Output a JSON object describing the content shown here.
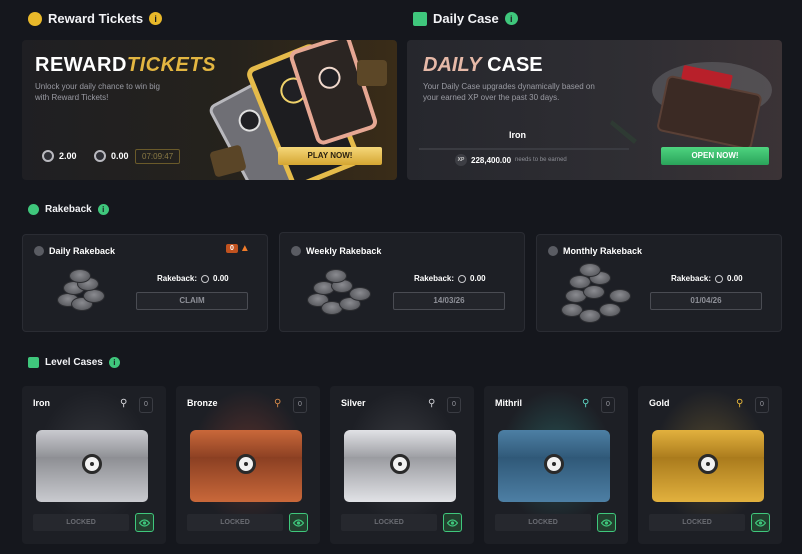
{
  "sections": {
    "reward_tickets": "Reward Tickets",
    "daily_case": "Daily Case",
    "rakeback": "Rakeback",
    "level_cases": "Level Cases"
  },
  "reward_banner": {
    "title_a": "REWARD",
    "title_b": "TICKETS",
    "desc1": "Unlock your daily chance to win big",
    "desc2": "with Reward Tickets!",
    "stat1": "2.00",
    "stat2": "0.00",
    "timer": "07:09:47",
    "play_label": "PLAY NOW!"
  },
  "daily_banner": {
    "title_a": "DAILY",
    "title_b": "CASE",
    "desc1": "Your Daily Case upgrades dynamically based on",
    "desc2": "your earned XP over the past 30 days.",
    "tier": "Iron",
    "xp_icon": "XP",
    "xp_value": "228,400.00",
    "xp_note": "needs to be earned",
    "open_label": "OPEN NOW!"
  },
  "rakeback_cards": [
    {
      "title": "Daily Rakeback",
      "label": "Rakeback:",
      "value": "0.00",
      "button": "CLAIM",
      "streak": "0"
    },
    {
      "title": "Weekly Rakeback",
      "label": "Rakeback:",
      "value": "0.00",
      "button": "14/03/26"
    },
    {
      "title": "Monthly Rakeback",
      "label": "Rakeback:",
      "value": "0.00",
      "button": "01/04/26"
    }
  ],
  "level_cases": [
    {
      "name": "Iron",
      "count": "0",
      "locked": "LOCKED",
      "key_color": "#d9d9de",
      "lid": "#c9cacf",
      "body": "#8d8e93",
      "glow": "rgba(255,255,255,0.10)"
    },
    {
      "name": "Bronze",
      "count": "0",
      "locked": "LOCKED",
      "key_color": "#d88a4a",
      "lid": "#c9683a",
      "body": "#8a3f22",
      "glow": "rgba(230,90,60,0.28)"
    },
    {
      "name": "Silver",
      "count": "0",
      "locked": "LOCKED",
      "key_color": "#cfd0d5",
      "lid": "#e1e2e6",
      "body": "#9a9ba0",
      "glow": "rgba(255,255,255,0.12)"
    },
    {
      "name": "Mithril",
      "count": "0",
      "locked": "LOCKED",
      "key_color": "#5fd6c4",
      "lid": "#4d7fa4",
      "body": "#2f5877",
      "glow": "rgba(60,200,190,0.28)"
    },
    {
      "name": "Gold",
      "count": "0",
      "locked": "LOCKED",
      "key_color": "#e8b83a",
      "lid": "#e2b13e",
      "body": "#a97a1c",
      "glow": "rgba(240,190,70,0.25)"
    }
  ],
  "icons": {
    "reward": "ticket-icon",
    "daily": "gift-box-icon",
    "rakeback": "refresh-icon",
    "level": "present-icon",
    "info": "i"
  },
  "colors": {
    "accent_gold": "#e3b641",
    "accent_green": "#3fc77c",
    "bg": "#15171d"
  }
}
